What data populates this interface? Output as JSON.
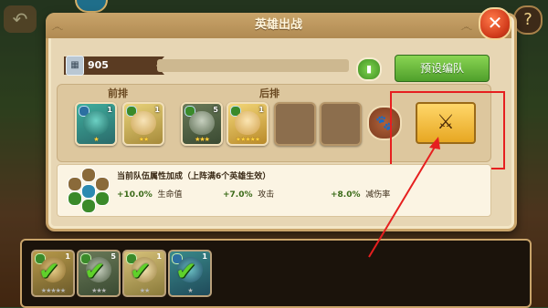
{
  "header": {
    "title": "英雄出战"
  },
  "power": {
    "value": "905"
  },
  "buttons": {
    "preset_label": "预设编队"
  },
  "lineup": {
    "front_label": "前排",
    "back_label": "后排",
    "front": [
      {
        "level": "1",
        "stars": "★",
        "name": "wizard-hero"
      },
      {
        "level": "1",
        "stars": "★★",
        "name": "archer-hero"
      }
    ],
    "back": [
      {
        "level": "5",
        "stars": "★★★",
        "name": "rhino-hero"
      },
      {
        "level": "1",
        "stars": "★★★★★",
        "name": "priestess-hero"
      }
    ]
  },
  "bonus": {
    "title": "当前队伍属性加成（上阵满6个英雄生效）",
    "stats": [
      {
        "value": "+10.0%",
        "label": "生命值"
      },
      {
        "value": "+7.0%",
        "label": "攻击"
      },
      {
        "value": "+8.0%",
        "label": "减伤率"
      }
    ]
  },
  "roster": [
    {
      "level": "1",
      "stars": "★★★★★"
    },
    {
      "level": "5",
      "stars": "★★★"
    },
    {
      "level": "1",
      "stars": "★★"
    },
    {
      "level": "1",
      "stars": "★"
    }
  ],
  "colors": {
    "accent_green": "#4f9f2b",
    "highlight_red": "#e61f1f",
    "battle_gold": "#e7a722"
  },
  "icons": {
    "close": "close-icon",
    "battle": "crossed-swords-icon",
    "paw": "paw-icon",
    "check": "check-icon"
  }
}
